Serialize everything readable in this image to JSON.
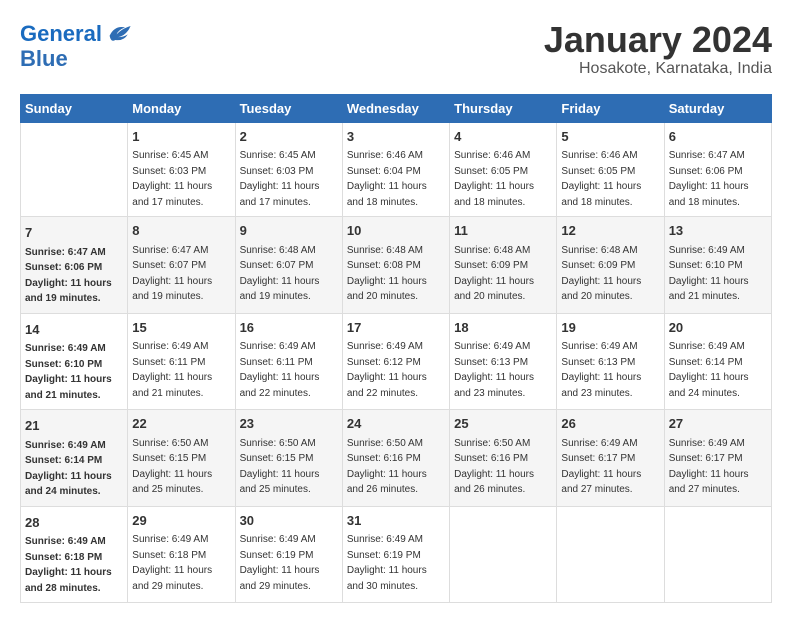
{
  "header": {
    "logo_general": "General",
    "logo_blue": "Blue",
    "month": "January 2024",
    "location": "Hosakote, Karnataka, India"
  },
  "weekdays": [
    "Sunday",
    "Monday",
    "Tuesday",
    "Wednesday",
    "Thursday",
    "Friday",
    "Saturday"
  ],
  "weeks": [
    [
      {
        "num": "",
        "detail": ""
      },
      {
        "num": "1",
        "detail": "Sunrise: 6:45 AM\nSunset: 6:03 PM\nDaylight: 11 hours\nand 17 minutes."
      },
      {
        "num": "2",
        "detail": "Sunrise: 6:45 AM\nSunset: 6:03 PM\nDaylight: 11 hours\nand 17 minutes."
      },
      {
        "num": "3",
        "detail": "Sunrise: 6:46 AM\nSunset: 6:04 PM\nDaylight: 11 hours\nand 18 minutes."
      },
      {
        "num": "4",
        "detail": "Sunrise: 6:46 AM\nSunset: 6:05 PM\nDaylight: 11 hours\nand 18 minutes."
      },
      {
        "num": "5",
        "detail": "Sunrise: 6:46 AM\nSunset: 6:05 PM\nDaylight: 11 hours\nand 18 minutes."
      },
      {
        "num": "6",
        "detail": "Sunrise: 6:47 AM\nSunset: 6:06 PM\nDaylight: 11 hours\nand 18 minutes."
      }
    ],
    [
      {
        "num": "7",
        "detail": "Sunrise: 6:47 AM\nSunset: 6:06 PM\nDaylight: 11 hours\nand 19 minutes."
      },
      {
        "num": "8",
        "detail": "Sunrise: 6:47 AM\nSunset: 6:07 PM\nDaylight: 11 hours\nand 19 minutes."
      },
      {
        "num": "9",
        "detail": "Sunrise: 6:48 AM\nSunset: 6:07 PM\nDaylight: 11 hours\nand 19 minutes."
      },
      {
        "num": "10",
        "detail": "Sunrise: 6:48 AM\nSunset: 6:08 PM\nDaylight: 11 hours\nand 20 minutes."
      },
      {
        "num": "11",
        "detail": "Sunrise: 6:48 AM\nSunset: 6:09 PM\nDaylight: 11 hours\nand 20 minutes."
      },
      {
        "num": "12",
        "detail": "Sunrise: 6:48 AM\nSunset: 6:09 PM\nDaylight: 11 hours\nand 20 minutes."
      },
      {
        "num": "13",
        "detail": "Sunrise: 6:49 AM\nSunset: 6:10 PM\nDaylight: 11 hours\nand 21 minutes."
      }
    ],
    [
      {
        "num": "14",
        "detail": "Sunrise: 6:49 AM\nSunset: 6:10 PM\nDaylight: 11 hours\nand 21 minutes."
      },
      {
        "num": "15",
        "detail": "Sunrise: 6:49 AM\nSunset: 6:11 PM\nDaylight: 11 hours\nand 21 minutes."
      },
      {
        "num": "16",
        "detail": "Sunrise: 6:49 AM\nSunset: 6:11 PM\nDaylight: 11 hours\nand 22 minutes."
      },
      {
        "num": "17",
        "detail": "Sunrise: 6:49 AM\nSunset: 6:12 PM\nDaylight: 11 hours\nand 22 minutes."
      },
      {
        "num": "18",
        "detail": "Sunrise: 6:49 AM\nSunset: 6:13 PM\nDaylight: 11 hours\nand 23 minutes."
      },
      {
        "num": "19",
        "detail": "Sunrise: 6:49 AM\nSunset: 6:13 PM\nDaylight: 11 hours\nand 23 minutes."
      },
      {
        "num": "20",
        "detail": "Sunrise: 6:49 AM\nSunset: 6:14 PM\nDaylight: 11 hours\nand 24 minutes."
      }
    ],
    [
      {
        "num": "21",
        "detail": "Sunrise: 6:49 AM\nSunset: 6:14 PM\nDaylight: 11 hours\nand 24 minutes."
      },
      {
        "num": "22",
        "detail": "Sunrise: 6:50 AM\nSunset: 6:15 PM\nDaylight: 11 hours\nand 25 minutes."
      },
      {
        "num": "23",
        "detail": "Sunrise: 6:50 AM\nSunset: 6:15 PM\nDaylight: 11 hours\nand 25 minutes."
      },
      {
        "num": "24",
        "detail": "Sunrise: 6:50 AM\nSunset: 6:16 PM\nDaylight: 11 hours\nand 26 minutes."
      },
      {
        "num": "25",
        "detail": "Sunrise: 6:50 AM\nSunset: 6:16 PM\nDaylight: 11 hours\nand 26 minutes."
      },
      {
        "num": "26",
        "detail": "Sunrise: 6:49 AM\nSunset: 6:17 PM\nDaylight: 11 hours\nand 27 minutes."
      },
      {
        "num": "27",
        "detail": "Sunrise: 6:49 AM\nSunset: 6:17 PM\nDaylight: 11 hours\nand 27 minutes."
      }
    ],
    [
      {
        "num": "28",
        "detail": "Sunrise: 6:49 AM\nSunset: 6:18 PM\nDaylight: 11 hours\nand 28 minutes."
      },
      {
        "num": "29",
        "detail": "Sunrise: 6:49 AM\nSunset: 6:18 PM\nDaylight: 11 hours\nand 29 minutes."
      },
      {
        "num": "30",
        "detail": "Sunrise: 6:49 AM\nSunset: 6:19 PM\nDaylight: 11 hours\nand 29 minutes."
      },
      {
        "num": "31",
        "detail": "Sunrise: 6:49 AM\nSunset: 6:19 PM\nDaylight: 11 hours\nand 30 minutes."
      },
      {
        "num": "",
        "detail": ""
      },
      {
        "num": "",
        "detail": ""
      },
      {
        "num": "",
        "detail": ""
      }
    ]
  ]
}
